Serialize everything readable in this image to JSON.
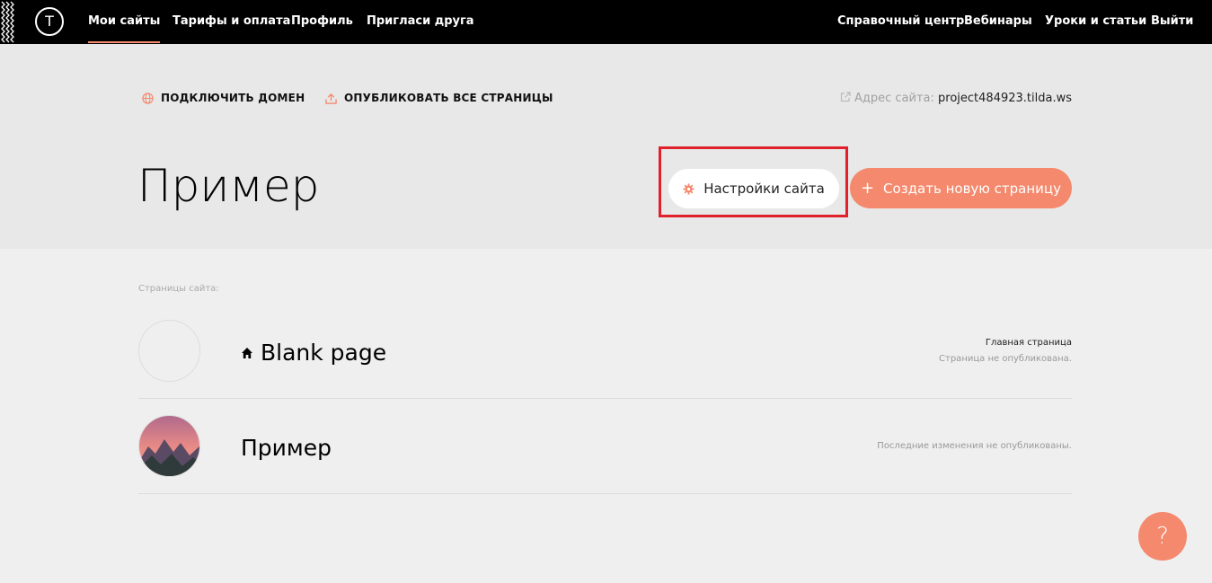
{
  "nav": {
    "logo": "T",
    "left": [
      "Мои сайты",
      "Тарифы и оплата",
      "Профиль",
      "Пригласи друга"
    ],
    "right": [
      "Справочный центр",
      "Вебинары",
      "Уроки и статьи",
      "Выйти"
    ]
  },
  "actions": {
    "connect_domain": "ПОДКЛЮЧИТЬ ДОМЕН",
    "publish_all": "ОПУБЛИКОВАТЬ ВСЕ СТРАНИЦЫ",
    "address_label": "Адрес сайта:",
    "address_value": "project484923.tilda.ws"
  },
  "site": {
    "title": "Пример",
    "settings_label": "Настройки сайта",
    "create_label": "Создать новую страницу"
  },
  "pages": {
    "label": "Страницы сайта:",
    "items": [
      {
        "title": "Blank page",
        "status_main": "Главная страница",
        "status_sub": "Страница не опубликована."
      },
      {
        "title": "Пример",
        "status_main": "",
        "status_sub": "Последние изменения не опубликованы."
      }
    ]
  },
  "help": {
    "label": "?"
  },
  "colors": {
    "accent": "#f4896d",
    "highlight": "#e0202a",
    "nav_bg": "#000000"
  }
}
